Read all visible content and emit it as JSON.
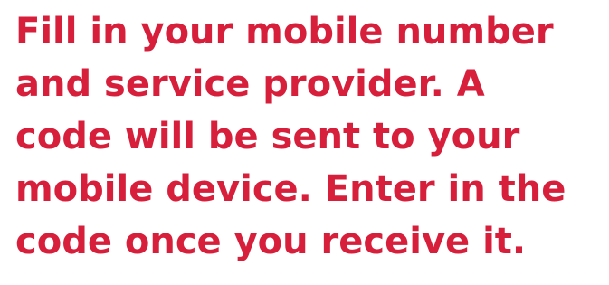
{
  "instructions": {
    "lines": [
      "Fill in your mobile number",
      "and service provider. A",
      "code will be sent to your",
      "mobile device. Enter in the",
      "code once you receive it."
    ]
  },
  "colors": {
    "text": "#d71f3c",
    "background": "#ffffff"
  }
}
